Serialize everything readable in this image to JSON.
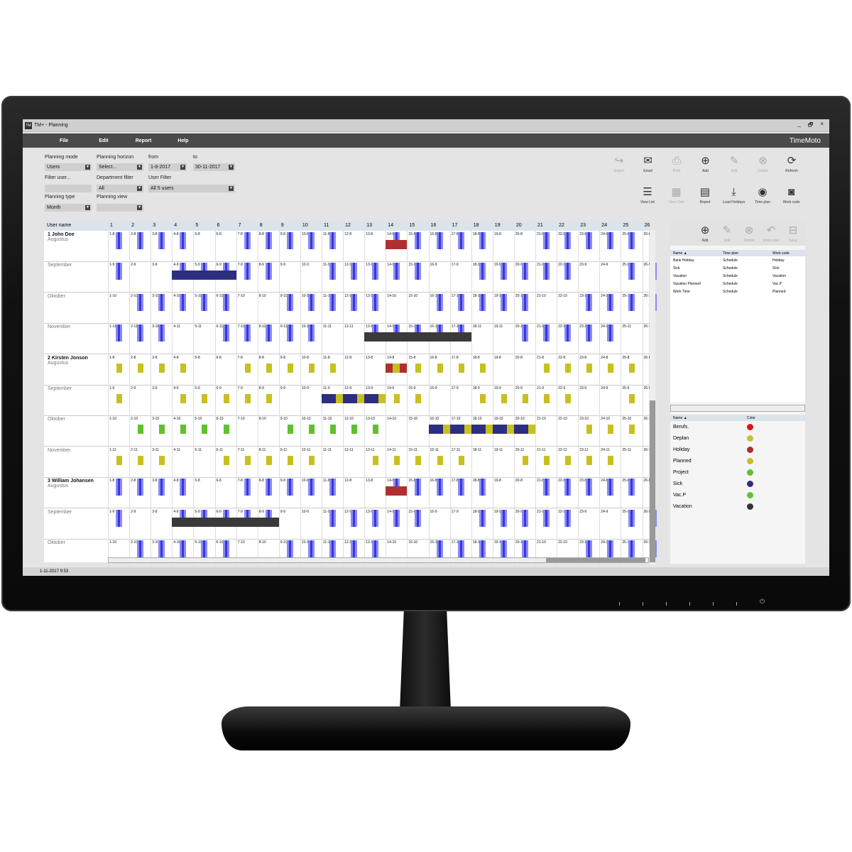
{
  "window": {
    "title": "TM+ - Planning",
    "app_icon": "TM",
    "controls": [
      "_",
      "🗗",
      "×"
    ]
  },
  "menu": {
    "items": [
      "File",
      "Edit",
      "Report",
      "Help"
    ],
    "brand": "TimeMoto"
  },
  "filters": {
    "planning_mode": {
      "label": "Planning mode",
      "value": "Users"
    },
    "planning_horizon": {
      "label": "Planning horizon",
      "value": "Select..."
    },
    "from": {
      "label": "from",
      "value": "1-8-2017"
    },
    "to": {
      "label": "to",
      "value": "30-11-2017"
    },
    "filter_user": {
      "label": "Filter user...",
      "value": ""
    },
    "department_filter": {
      "label": "Department filter",
      "value": "All"
    },
    "user_filter": {
      "label": "User Filter",
      "value": "All 5 users"
    },
    "planning_type": {
      "label": "Planning type",
      "value": "Month"
    },
    "planning_view": {
      "label": "Planning view",
      "value": ""
    }
  },
  "toolbar": {
    "row1": [
      {
        "label": "Export",
        "icon": "export-icon",
        "enabled": false
      },
      {
        "label": "Email",
        "icon": "email-icon",
        "enabled": true
      },
      {
        "label": "Print",
        "icon": "print-icon",
        "enabled": false
      },
      {
        "label": "Add",
        "icon": "add-icon",
        "enabled": true
      },
      {
        "label": "Edit",
        "icon": "edit-icon",
        "enabled": false
      },
      {
        "label": "Delete",
        "icon": "delete-icon",
        "enabled": false
      },
      {
        "label": "Refresh",
        "icon": "refresh-icon",
        "enabled": true
      }
    ],
    "row2": [
      {
        "label": "View List",
        "icon": "view-list-icon",
        "enabled": true
      },
      {
        "label": "View Grid",
        "icon": "view-grid-icon",
        "enabled": false
      },
      {
        "label": "Report",
        "icon": "report-icon",
        "enabled": true
      },
      {
        "label": "Load Holidays",
        "icon": "load-holidays-icon",
        "enabled": true
      },
      {
        "label": "Time plan",
        "icon": "time-plan-icon",
        "enabled": true
      },
      {
        "label": "Work code",
        "icon": "work-code-icon",
        "enabled": true
      }
    ]
  },
  "grid": {
    "header_label": "User name",
    "days": [
      "1",
      "2",
      "3",
      "4",
      "5",
      "6",
      "7",
      "8",
      "9",
      "10",
      "11",
      "12",
      "13",
      "14",
      "15",
      "16",
      "17",
      "18",
      "19",
      "20",
      "21",
      "22",
      "23",
      "24",
      "25",
      "26"
    ],
    "rows": [
      {
        "user": "1 John Doe",
        "month": "Augustus",
        "m": 8,
        "style": "blue",
        "work_days": [
          1,
          2,
          3,
          4,
          7,
          8,
          9,
          10,
          11,
          14,
          15,
          16,
          17,
          18,
          21,
          22,
          23,
          24,
          25
        ],
        "spans": [
          {
            "from": 14,
            "to": 14,
            "color": "holiday"
          }
        ]
      },
      {
        "user": "",
        "month": "September",
        "m": 9,
        "style": "blue",
        "work_days": [
          1,
          4,
          5,
          6,
          7,
          8,
          11,
          12,
          13,
          14,
          15,
          18,
          19,
          20,
          21,
          22,
          25,
          26
        ],
        "spans": [
          {
            "from": 4,
            "to": 6,
            "color": "sick"
          }
        ]
      },
      {
        "user": "",
        "month": "Oktober",
        "m": 10,
        "style": "blue",
        "work_days": [
          2,
          3,
          4,
          5,
          6,
          9,
          10,
          11,
          12,
          13,
          16,
          17,
          18,
          19,
          20,
          23,
          24,
          25,
          26
        ],
        "spans": []
      },
      {
        "user": "",
        "month": "November",
        "m": 11,
        "style": "blue",
        "work_days": [
          1,
          2,
          3,
          6,
          7,
          8,
          9,
          10,
          13,
          14,
          15,
          16,
          17,
          20,
          21,
          22,
          23,
          24
        ],
        "spans": [
          {
            "from": 13,
            "to": 17,
            "color": "vacation"
          }
        ]
      },
      {
        "user": "2 Kirsten Jonson",
        "month": "Augustus",
        "m": 8,
        "style": "planned",
        "work_days": [
          1,
          2,
          3,
          4,
          7,
          8,
          9,
          10,
          11,
          15,
          16,
          17,
          18,
          21,
          22,
          23,
          24,
          25
        ],
        "spans": [
          {
            "from": 14,
            "to": 14,
            "color": "holiday_mix"
          }
        ]
      },
      {
        "user": "",
        "month": "September",
        "m": 9,
        "style": "planned",
        "work_days": [
          1,
          4,
          5,
          6,
          7,
          8,
          14,
          15,
          18,
          19,
          20,
          21,
          22,
          25
        ],
        "spans": [
          {
            "from": 11,
            "to": 13,
            "color": "sick_mix"
          }
        ]
      },
      {
        "user": "",
        "month": "Oktober",
        "m": 10,
        "style": "project",
        "work_days": [
          2,
          3,
          4,
          5,
          6,
          9,
          10,
          11,
          12,
          13
        ],
        "extra_planned": [
          23,
          24,
          25
        ],
        "spans": [
          {
            "from": 16,
            "to": 20,
            "color": "sick_mix"
          }
        ]
      },
      {
        "user": "",
        "month": "November",
        "m": 11,
        "style": "planned",
        "work_days": [
          1,
          2,
          3,
          6,
          7,
          8,
          9,
          10,
          13,
          14,
          15,
          16,
          17,
          20,
          21,
          22,
          23,
          24
        ],
        "spans": []
      },
      {
        "user": "3 William Johansen",
        "month": "Augustus",
        "m": 8,
        "style": "blue",
        "work_days": [
          1,
          2,
          3,
          4,
          7,
          8,
          9,
          10,
          11,
          14,
          15,
          16,
          17,
          18,
          21,
          22,
          23,
          24,
          25
        ],
        "spans": [
          {
            "from": 14,
            "to": 14,
            "color": "holiday"
          }
        ]
      },
      {
        "user": "",
        "month": "September",
        "m": 9,
        "style": "blue",
        "work_days": [
          1,
          4,
          5,
          6,
          7,
          8,
          11,
          12,
          13,
          14,
          15,
          18,
          19,
          20,
          21,
          22,
          25,
          26
        ],
        "spans": [
          {
            "from": 4,
            "to": 8,
            "color": "vacation"
          }
        ]
      },
      {
        "user": "",
        "month": "Oktober",
        "m": 10,
        "style": "blue",
        "work_days": [
          2,
          3,
          4,
          5,
          6,
          9,
          10,
          11,
          12,
          13,
          16,
          17,
          18,
          19,
          20,
          23,
          24,
          25,
          26
        ],
        "spans": []
      }
    ]
  },
  "right_panel": {
    "toolbar": [
      {
        "label": "Add",
        "icon": "add-icon",
        "enabled": true
      },
      {
        "label": "Edit",
        "icon": "edit-icon",
        "enabled": false
      },
      {
        "label": "Delete",
        "icon": "delete-icon",
        "enabled": false
      },
      {
        "label": "Undo plan",
        "icon": "undo-icon",
        "enabled": false
      },
      {
        "label": "Save",
        "icon": "save-icon",
        "enabled": false
      }
    ],
    "plans_table": {
      "headers": [
        "Name ▲",
        "Time plan",
        "Work code"
      ],
      "rows": [
        [
          "Bank Holiday",
          "Schedule",
          "Holiday"
        ],
        [
          "Sick",
          "Schedule",
          "Sick"
        ],
        [
          "Vacation",
          "Schedule",
          "Vacation"
        ],
        [
          "Vacation Planned",
          "Schedule",
          "Vac.P"
        ],
        [
          "Work Time",
          "Schedule",
          "Planned"
        ]
      ]
    },
    "legend": {
      "headers": [
        "Name ▲",
        "Color"
      ],
      "rows": [
        {
          "name": "Berufs.",
          "color": "#e01010"
        },
        {
          "name": "Deplan",
          "color": "#c4c040"
        },
        {
          "name": "Holiday",
          "color": "#a83030"
        },
        {
          "name": "Planned",
          "color": "#c8c020"
        },
        {
          "name": "Project",
          "color": "#60c030"
        },
        {
          "name": "Sick",
          "color": "#2e2e80"
        },
        {
          "name": "Vac.P",
          "color": "#60c040"
        },
        {
          "name": "Vacation",
          "color": "#333333"
        }
      ]
    }
  },
  "colors": {
    "work": "#3636e6",
    "planned": "#c8c020",
    "project": "#60c030",
    "holiday": "#b03030",
    "sick": "#2e2e80",
    "vacation": "#3a3a3a"
  },
  "status": {
    "datetime": "1-11-2017 9:53"
  }
}
